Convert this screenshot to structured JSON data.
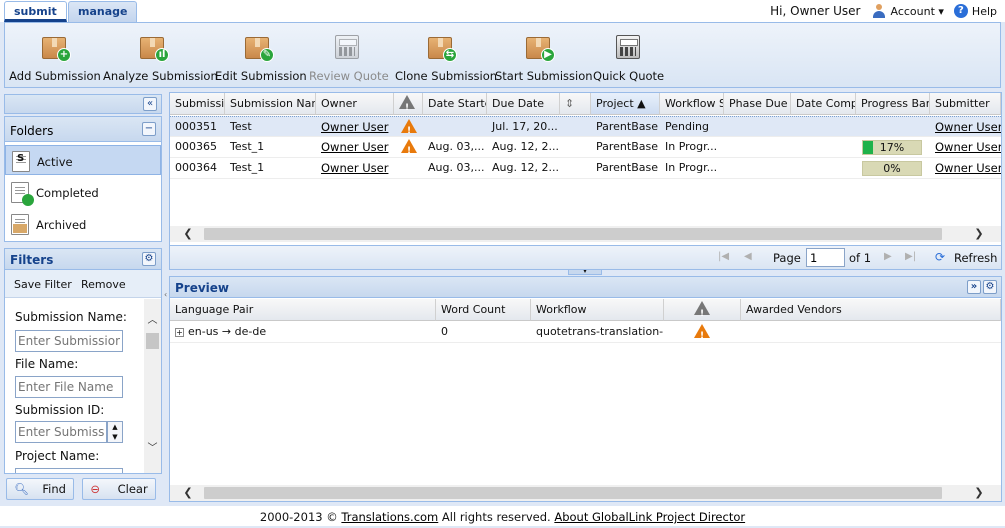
{
  "tabs": [
    {
      "label": "submit"
    },
    {
      "label": "manage"
    }
  ],
  "header": {
    "greeting": "Hi, Owner User",
    "account_label": "Account ▾",
    "help_label": "Help"
  },
  "toolbar": {
    "buttons": [
      {
        "label": "Add Submission",
        "icon": "add-submission-icon",
        "enabled": true
      },
      {
        "label": "Analyze Submission",
        "icon": "analyze-submission-icon",
        "enabled": true
      },
      {
        "label": "Edit Submission",
        "icon": "edit-submission-icon",
        "enabled": true
      },
      {
        "label": "Review Quote",
        "icon": "review-quote-icon",
        "enabled": false
      },
      {
        "label": "Clone Submission",
        "icon": "clone-submission-icon",
        "enabled": true
      },
      {
        "label": "Start Submission",
        "icon": "start-submission-icon",
        "enabled": true
      },
      {
        "label": "Quick Quote",
        "icon": "quick-quote-icon",
        "enabled": true
      }
    ]
  },
  "folders": {
    "title": "Folders",
    "items": [
      {
        "label": "Active"
      },
      {
        "label": "Completed"
      },
      {
        "label": "Archived"
      }
    ]
  },
  "filters": {
    "title": "Filters",
    "save_label": "Save Filter",
    "remove_label": "Remove",
    "fields": [
      {
        "label": "Submission Name:",
        "placeholder": "Enter Submission N"
      },
      {
        "label": "File Name:",
        "placeholder": "Enter File Name"
      },
      {
        "label": "Submission ID:",
        "placeholder": "Enter Submissio"
      },
      {
        "label": "Project Name:"
      }
    ],
    "find_label": "Find",
    "clear_label": "Clear"
  },
  "grid": {
    "columns": [
      "Submissio",
      "Submission Name",
      "Owner",
      "",
      "Date Started",
      "Due Date",
      "",
      "Project ▲",
      "Workflow St",
      "Phase Due D",
      "Date Compl",
      "Progress Bar",
      "Submitter"
    ],
    "rows": [
      {
        "id": "000351",
        "name": "Test",
        "owner": "Owner User",
        "warning": true,
        "date_started": "",
        "due_date": "Jul. 17, 20...",
        "project": "ParentBase",
        "workflow": "Pending",
        "progress": null,
        "progress_label": "",
        "submitter": "Owner User"
      },
      {
        "id": "000365",
        "name": "Test_1",
        "owner": "Owner User",
        "warning": true,
        "date_started": "Aug. 03,...",
        "due_date": "Aug. 12, 2...",
        "project": "ParentBase",
        "workflow": "In Progr...",
        "progress": 17,
        "progress_label": "17%",
        "submitter": "Owner User"
      },
      {
        "id": "000364",
        "name": "Test_1",
        "owner": "Owner User",
        "warning": false,
        "date_started": "Aug. 03,...",
        "due_date": "Aug. 12, 2...",
        "project": "ParentBase",
        "workflow": "In Progr...",
        "progress": 0,
        "progress_label": "0%",
        "submitter": "Owner User"
      }
    ]
  },
  "pager": {
    "page_label": "Page",
    "page_value": "1",
    "of_label": "of 1",
    "refresh_label": "Refresh"
  },
  "preview": {
    "title": "Preview",
    "columns": [
      "Language Pair",
      "Word Count",
      "Workflow",
      "",
      "Awarded Vendors"
    ],
    "rows": [
      {
        "expand": "+",
        "language_pair": "en-us → de-de",
        "word_count": "0",
        "workflow": "quotetrans-translation-...",
        "warning": true,
        "vendors": ""
      }
    ]
  },
  "footer": {
    "prefix": "2000-2013 © ",
    "company_link": "Translations.com",
    "middle": " All rights reserved. ",
    "about_link": "About GlobalLink Project Director"
  },
  "colors": {
    "accent": "#15428b",
    "border": "#99bbe8",
    "warning": "#e87a0c",
    "progress": "#1fb24a"
  }
}
